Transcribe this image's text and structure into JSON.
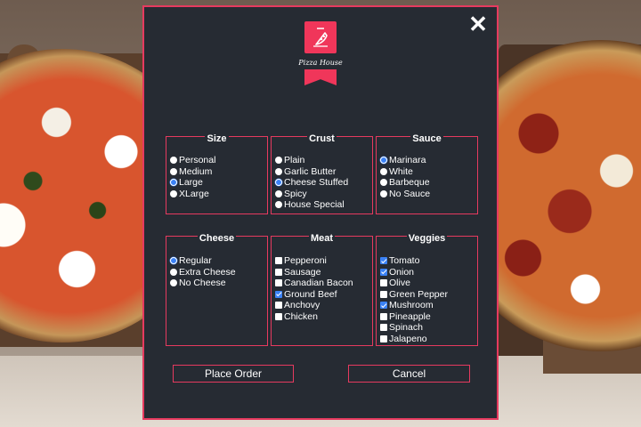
{
  "modal": {
    "brand": "Pizza House",
    "close_label": "✕"
  },
  "groups": {
    "size": {
      "title": "Size",
      "type": "radio",
      "options": [
        {
          "label": "Personal",
          "selected": false
        },
        {
          "label": "Medium",
          "selected": false
        },
        {
          "label": "Large",
          "selected": true
        },
        {
          "label": "XLarge",
          "selected": false
        }
      ]
    },
    "crust": {
      "title": "Crust",
      "type": "radio",
      "options": [
        {
          "label": "Plain",
          "selected": false
        },
        {
          "label": "Garlic Butter",
          "selected": false
        },
        {
          "label": "Cheese Stuffed",
          "selected": true
        },
        {
          "label": "Spicy",
          "selected": false
        },
        {
          "label": "House Special",
          "selected": false
        }
      ]
    },
    "sauce": {
      "title": "Sauce",
      "type": "radio",
      "options": [
        {
          "label": "Marinara",
          "selected": true
        },
        {
          "label": "White",
          "selected": false
        },
        {
          "label": "Barbeque",
          "selected": false
        },
        {
          "label": "No Sauce",
          "selected": false
        }
      ]
    },
    "cheese": {
      "title": "Cheese",
      "type": "radio",
      "options": [
        {
          "label": "Regular",
          "selected": true
        },
        {
          "label": "Extra Cheese",
          "selected": false
        },
        {
          "label": "No Cheese",
          "selected": false
        }
      ]
    },
    "meat": {
      "title": "Meat",
      "type": "checkbox",
      "options": [
        {
          "label": "Pepperoni",
          "selected": false
        },
        {
          "label": "Sausage",
          "selected": false
        },
        {
          "label": "Canadian Bacon",
          "selected": false
        },
        {
          "label": "Ground Beef",
          "selected": true
        },
        {
          "label": "Anchovy",
          "selected": false
        },
        {
          "label": "Chicken",
          "selected": false
        }
      ]
    },
    "veggies": {
      "title": "Veggies",
      "type": "checkbox",
      "options": [
        {
          "label": "Tomato",
          "selected": true
        },
        {
          "label": "Onion",
          "selected": true
        },
        {
          "label": "Olive",
          "selected": false
        },
        {
          "label": "Green Pepper",
          "selected": false
        },
        {
          "label": "Mushroom",
          "selected": true
        },
        {
          "label": "Pineapple",
          "selected": false
        },
        {
          "label": "Spinach",
          "selected": false
        },
        {
          "label": "Jalapeno",
          "selected": false
        }
      ]
    }
  },
  "actions": {
    "place_order": "Place Order",
    "cancel": "Cancel"
  },
  "colors": {
    "accent": "#e63a5f",
    "panel": "#262b33",
    "selected": "#3b82f6"
  }
}
